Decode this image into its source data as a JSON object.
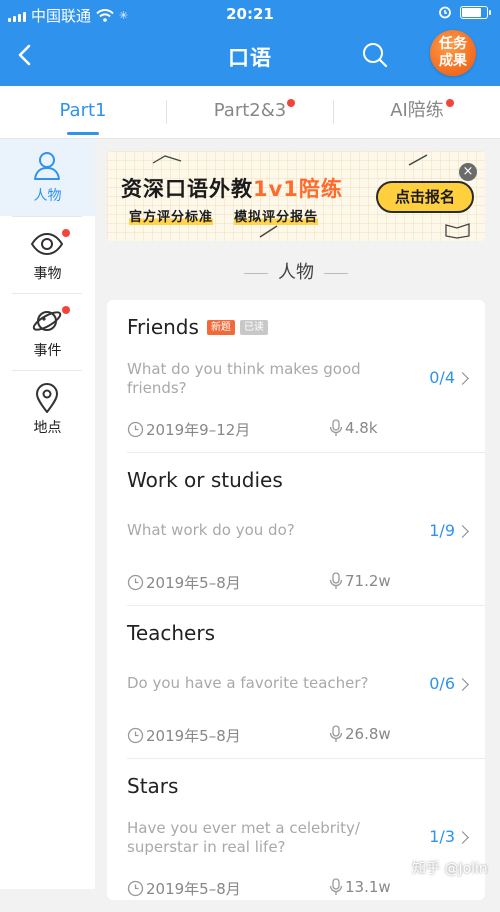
{
  "status_bar": {
    "carrier": "中国联通",
    "time": "20:21",
    "battery_level": 0.85
  },
  "header": {
    "title": "口语",
    "task_button": "任务\n成果"
  },
  "tabs": [
    {
      "label": "Part1",
      "active": true,
      "dot": false
    },
    {
      "label": "Part2&3",
      "active": false,
      "dot": true
    },
    {
      "label": "AI陪练",
      "active": false,
      "dot": true
    }
  ],
  "sidebar": {
    "items": [
      {
        "label": "人物",
        "icon": "person-icon",
        "active": true,
        "dot": false
      },
      {
        "label": "事物",
        "icon": "eye-icon",
        "active": false,
        "dot": true
      },
      {
        "label": "事件",
        "icon": "planet-icon",
        "active": false,
        "dot": true
      },
      {
        "label": "地点",
        "icon": "location-pin-icon",
        "active": false,
        "dot": false
      }
    ]
  },
  "banner": {
    "headline_a": "资深口语外教",
    "headline_b": "1v1陪练",
    "subline_a": "官方评分标准",
    "subline_b": "模拟评分报告",
    "cta": "点击报名",
    "close": "×"
  },
  "section_title": "人物",
  "topics": [
    {
      "name": "Friends",
      "badge_new": "新题",
      "badge_read": "已读",
      "question": "What do you think makes good friends?",
      "progress": "0/4",
      "date": "2019年9–12月",
      "plays": "4.8k"
    },
    {
      "name": "Work or studies",
      "question": "What work do you do?",
      "progress": "1/9",
      "date": "2019年5–8月",
      "plays": "71.2w"
    },
    {
      "name": "Teachers",
      "question": "Do you have a favorite teacher?",
      "progress": "0/6",
      "date": "2019年5–8月",
      "plays": "26.8w"
    },
    {
      "name": "Stars",
      "question": "Have you ever met a celebrity/ superstar in real life?",
      "progress": "1/3",
      "date": "2019年5–8月",
      "plays": "13.1w"
    }
  ],
  "watermark": "知乎 @Jolin",
  "colors": {
    "primary": "#2f93ee",
    "accent": "#f36a1d",
    "badge_new": "#f36a3a",
    "dot": "#f2453a"
  }
}
